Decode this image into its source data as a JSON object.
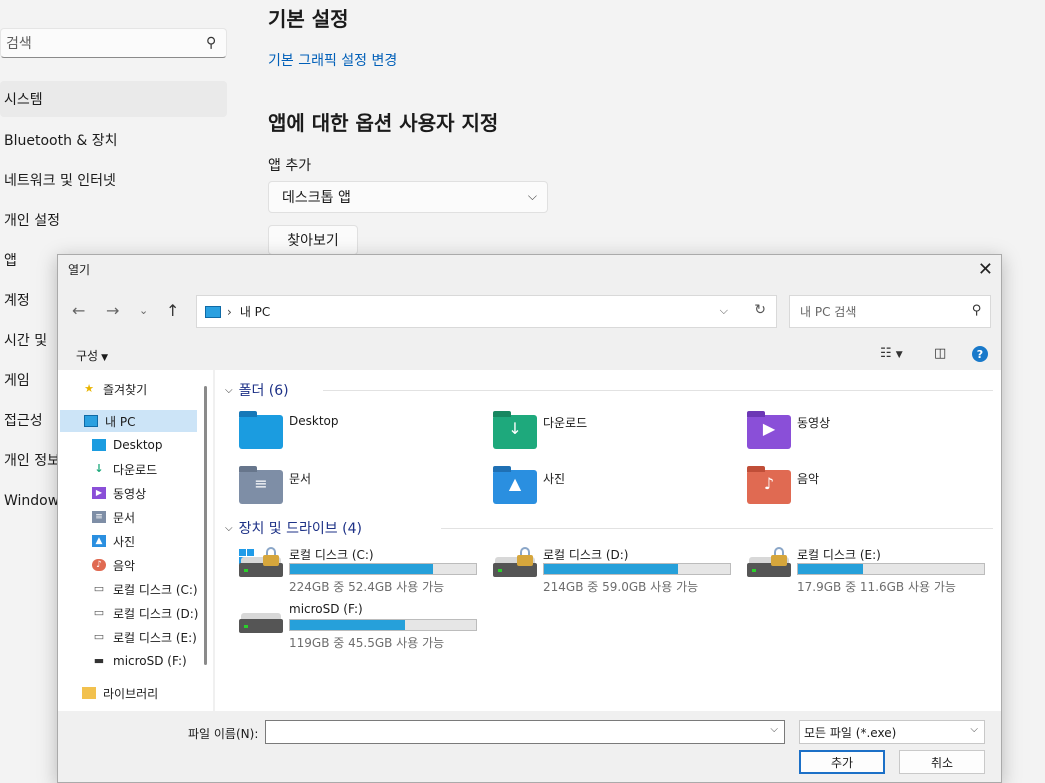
{
  "settings": {
    "search_placeholder": "검색",
    "nav": [
      "시스템",
      "Bluetooth & 장치",
      "네트워크 및 인터넷",
      "개인 설정",
      "앱",
      "계정",
      "시간 및",
      "게임",
      "접근성",
      "개인 정보",
      "Windows"
    ],
    "heading_basic": "기본 설정",
    "link_graphics": "기본 그래픽 설정 변경",
    "heading_custom": "앱에 대한 옵션 사용자 지정",
    "add_app_label": "앱 추가",
    "app_type_value": "데스크톱 앱",
    "browse_label": "찾아보기"
  },
  "dialog": {
    "title": "열기",
    "address": "내 PC",
    "search_placeholder": "내 PC 검색",
    "organize_label": "구성",
    "tree": {
      "quick_access": "즐겨찾기",
      "this_pc": "내 PC",
      "children": [
        "Desktop",
        "다운로드",
        "동영상",
        "문서",
        "사진",
        "음악",
        "로컬 디스크 (C:)",
        "로컬 디스크 (D:)",
        "로컬 디스크 (E:)",
        "microSD (F:)"
      ],
      "libraries": "라이브러리"
    },
    "folders_header": "폴더 (6)",
    "folders": [
      {
        "name": "Desktop",
        "icon": "desktop-folder-icon",
        "color": "#1b9ce0"
      },
      {
        "name": "다운로드",
        "icon": "downloads-folder-icon",
        "color": "#1ea97c"
      },
      {
        "name": "동영상",
        "icon": "videos-folder-icon",
        "color": "#8a4fd8"
      },
      {
        "name": "문서",
        "icon": "documents-folder-icon",
        "color": "#7e8ea6"
      },
      {
        "name": "사진",
        "icon": "pictures-folder-icon",
        "color": "#2a8fe0"
      },
      {
        "name": "음악",
        "icon": "music-folder-icon",
        "color": "#e06a52"
      }
    ],
    "drives_header": "장치 및 드라이브 (4)",
    "drives": [
      {
        "name": "로컬 디스크 (C:)",
        "space": "224GB 중 52.4GB 사용 가능",
        "used_fraction": 0.77,
        "locked": true,
        "windows": true
      },
      {
        "name": "로컬 디스크 (D:)",
        "space": "214GB 중 59.0GB 사용 가능",
        "used_fraction": 0.72,
        "locked": true,
        "windows": false
      },
      {
        "name": "로컬 디스크 (E:)",
        "space": "17.9GB 중 11.6GB 사용 가능",
        "used_fraction": 0.35,
        "locked": true,
        "windows": false
      },
      {
        "name": "microSD (F:)",
        "space": "119GB 중 45.5GB 사용 가능",
        "used_fraction": 0.62,
        "locked": false,
        "windows": false
      }
    ],
    "filename_label": "파일 이름(N):",
    "filename_value": "",
    "filter_value": "모든 파일 (*.exe)",
    "add_button": "추가",
    "cancel_button": "취소"
  }
}
